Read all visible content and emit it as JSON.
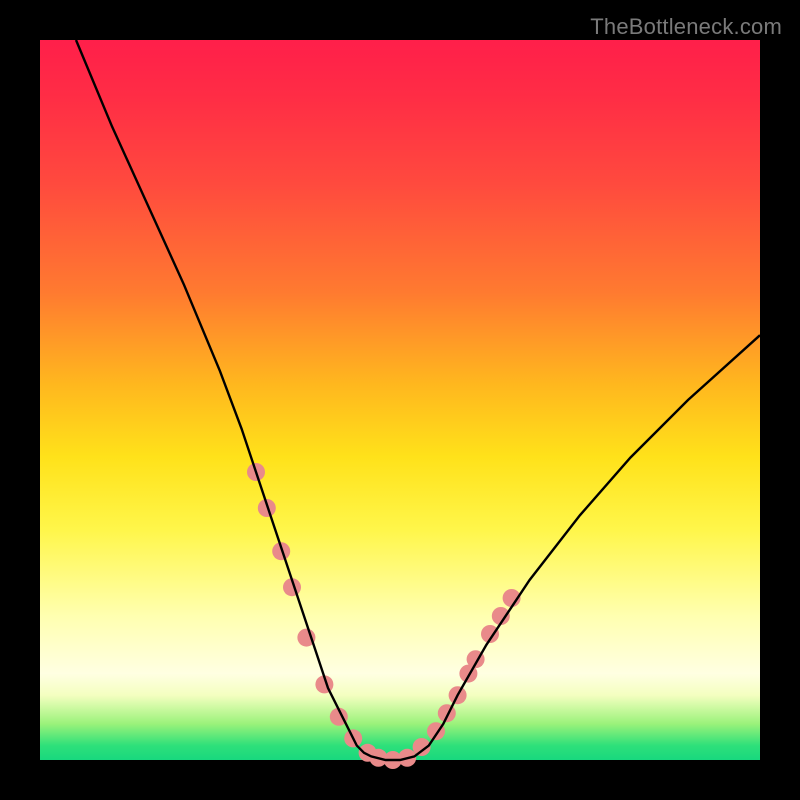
{
  "watermark": {
    "text": "TheBottleneck.com"
  },
  "chart_data": {
    "type": "line",
    "title": "",
    "xlabel": "",
    "ylabel": "",
    "xlim": [
      0,
      100
    ],
    "ylim": [
      0,
      100
    ],
    "grid": false,
    "legend": false,
    "background_gradient": {
      "orientation": "vertical",
      "stops": [
        {
          "pos": 0.0,
          "color": "#ff1f4a"
        },
        {
          "pos": 0.35,
          "color": "#ff7a30"
        },
        {
          "pos": 0.58,
          "color": "#ffe21a"
        },
        {
          "pos": 0.88,
          "color": "#ffffe2"
        },
        {
          "pos": 1.0,
          "color": "#18d87e"
        }
      ]
    },
    "series": [
      {
        "name": "curve",
        "color": "#000000",
        "x": [
          5,
          10,
          15,
          20,
          25,
          28,
          30,
          32,
          34,
          36,
          38,
          40,
          42,
          43,
          44,
          45,
          46,
          48,
          50,
          52,
          54,
          56,
          58,
          62,
          68,
          75,
          82,
          90,
          100
        ],
        "y": [
          100,
          88,
          77,
          66,
          54,
          46,
          40,
          34,
          28,
          22,
          16,
          10,
          6,
          4,
          2,
          1,
          0.5,
          0,
          0,
          0.5,
          2,
          5,
          9,
          16,
          25,
          34,
          42,
          50,
          59
        ]
      }
    ],
    "markers": {
      "color": "#e98a8a",
      "radius_px": 9,
      "points": [
        {
          "x": 30,
          "y": 40
        },
        {
          "x": 31.5,
          "y": 35
        },
        {
          "x": 33.5,
          "y": 29
        },
        {
          "x": 35,
          "y": 24
        },
        {
          "x": 37,
          "y": 17
        },
        {
          "x": 39.5,
          "y": 10.5
        },
        {
          "x": 41.5,
          "y": 6
        },
        {
          "x": 43.5,
          "y": 3
        },
        {
          "x": 45.5,
          "y": 1
        },
        {
          "x": 47,
          "y": 0.3
        },
        {
          "x": 49,
          "y": 0
        },
        {
          "x": 51,
          "y": 0.3
        },
        {
          "x": 53,
          "y": 1.8
        },
        {
          "x": 55,
          "y": 4
        },
        {
          "x": 56.5,
          "y": 6.5
        },
        {
          "x": 58,
          "y": 9
        },
        {
          "x": 59.5,
          "y": 12
        },
        {
          "x": 60.5,
          "y": 14
        },
        {
          "x": 62.5,
          "y": 17.5
        },
        {
          "x": 64,
          "y": 20
        },
        {
          "x": 65.5,
          "y": 22.5
        }
      ]
    }
  }
}
